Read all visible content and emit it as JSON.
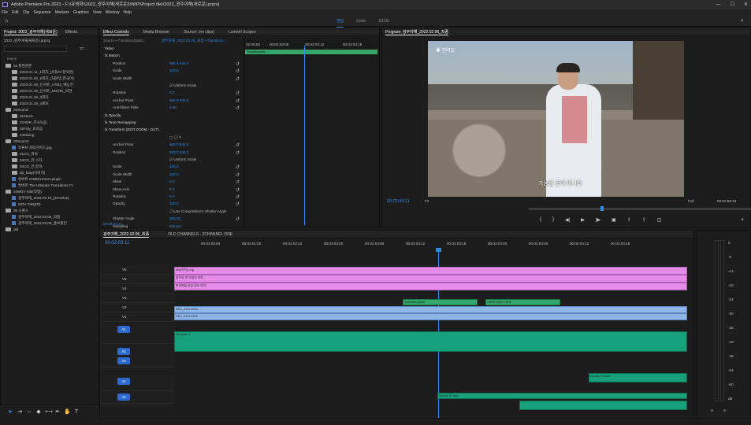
{
  "window": {
    "title": "Adobe Premiere Pro 2021 - F:\\\\유영화\\\\2022_광주야해(새로운)\\\\WIP\\\\Project file\\\\2022_광주야해(새로운).prproj",
    "min": "—",
    "max": "☐",
    "close": "✕"
  },
  "menu": [
    "File",
    "Edit",
    "Clip",
    "Sequence",
    "Markers",
    "Graphics",
    "View",
    "Window",
    "Help"
  ],
  "workspaces": {
    "tabs": [
      "편집",
      "Color",
      "오디오"
    ],
    "active": 0
  },
  "project": {
    "tab": "Project: 2022_광주야해(새로운)",
    "tab2": "Effects",
    "path": "2022_광주야해(새로운).prproj",
    "count": "37...",
    "col": "Name",
    "items": [
      {
        "t": "folder",
        "l": "01.촬영원본",
        "i": 0
      },
      {
        "t": "folder",
        "l": "2022.01.11_1회차_(유튜브 분석본)",
        "i": 1
      },
      {
        "t": "folder",
        "l": "2022.01.20_2회차_(대본민,한국어)",
        "i": 1
      },
      {
        "t": "folder",
        "l": "2022.01.28_인서트_A7M3_예능진",
        "i": 1
      },
      {
        "t": "folder",
        "l": "2022.01.28_인서트_NIKON_박현",
        "i": 1
      },
      {
        "t": "folder",
        "l": "2022.01.29_3회차",
        "i": 1
      },
      {
        "t": "folder",
        "l": "2022.01.29_4회차",
        "i": 1
      },
      {
        "t": "folder",
        "l": "02Sound",
        "i": 0
      },
      {
        "t": "folder",
        "l": "01Music",
        "i": 1
      },
      {
        "t": "folder",
        "l": "02ADR_추사녹음",
        "i": 1
      },
      {
        "t": "folder",
        "l": "03Foly_효과음",
        "i": 1
      },
      {
        "t": "folder",
        "l": "04Mixing",
        "i": 1
      },
      {
        "t": "folder",
        "l": "03Source",
        "i": 0
      },
      {
        "t": "clip",
        "l": "유튜브 자막가이드.jpg",
        "i": 1
      },
      {
        "t": "folder",
        "l": "01CG_자막",
        "i": 1
      },
      {
        "t": "folder",
        "l": "03CG_전 스타",
        "i": 1
      },
      {
        "t": "folder",
        "l": "04CG_전 끝까",
        "i": 1
      },
      {
        "t": "folder",
        "l": "06_Map(이미지)",
        "i": 1
      },
      {
        "t": "clip",
        "l": "컨버트 CINEPUNCH plugin",
        "i": 1
      },
      {
        "t": "clip",
        "l": "컨버트 The Ultimate Transitions Fx",
        "i": 1
      },
      {
        "t": "folder",
        "l": "04MOV File(작업)",
        "i": 0
      },
      {
        "t": "clip",
        "l": "광주야해_2022.02.10_(Resolve)",
        "i": 1
      },
      {
        "t": "clip",
        "l": "MOV File(ED)",
        "i": 1
      },
      {
        "t": "folder",
        "l": "05.시퀀스",
        "i": 0
      },
      {
        "t": "clip",
        "l": "광주야해_2022.02.06_최종",
        "i": 1
      },
      {
        "t": "clip",
        "l": "광주야해_2022.02.06_풍보풍인",
        "i": 1
      },
      {
        "t": "folder",
        "l": "old",
        "i": 0
      }
    ]
  },
  "effects": {
    "tabs": [
      "Effect Controls",
      "Media Browser",
      "Source: (no clips)",
      "Lumetri Scopes"
    ],
    "source": "Source • Transition(fade)...",
    "seq": "광주야해_2022.02.06_최종 • Transition...",
    "rows": [
      {
        "l": "Video",
        "v": "",
        "h": 1
      },
      {
        "l": "fx  Motion",
        "v": "",
        "h": 1
      },
      {
        "l": "Position",
        "v": "960.0   540.0",
        "k": 1
      },
      {
        "l": "Scale",
        "v": "100.0",
        "k": 1
      },
      {
        "l": "Scale Width",
        "v": "",
        "k": 1
      },
      {
        "l": "",
        "v": "☑ Uniform Scale"
      },
      {
        "l": "Rotation",
        "v": "0.0",
        "k": 1
      },
      {
        "l": "Anchor Point",
        "v": "960.0   540.0",
        "k": 1
      },
      {
        "l": "Anti-flicker Filter",
        "v": "0.00",
        "k": 1
      },
      {
        "l": "fx  Opacity",
        "v": "",
        "h": 1
      },
      {
        "l": "fx  Time Remapping",
        "v": "",
        "h": 1
      },
      {
        "l": "fx  Transform (EDIT.ZOOM - OUT)",
        "v": "",
        "h": 1
      },
      {
        "l": "",
        "v": "▢ ◯ ✎"
      },
      {
        "l": "Anchor Point",
        "v": "960.0   540.0",
        "k": 1
      },
      {
        "l": "Position",
        "v": "960.0   540.0",
        "k": 1
      },
      {
        "l": "",
        "v": "☑ Uniform Scale"
      },
      {
        "l": "Scale",
        "v": "100.0",
        "k": 1
      },
      {
        "l": "Scale Width",
        "v": "100.0",
        "k": 1
      },
      {
        "l": "Skew",
        "v": "0.0",
        "k": 1
      },
      {
        "l": "Skew Axis",
        "v": "0.0",
        "k": 1
      },
      {
        "l": "Rotation",
        "v": "0.0",
        "k": 1
      },
      {
        "l": "Opacity",
        "v": "100.0",
        "k": 1
      },
      {
        "l": "",
        "v": "☐ Use Composition's Shutter Angle"
      },
      {
        "l": "Shutter Angle",
        "v": "180.00",
        "k": 1
      },
      {
        "l": "Sampling",
        "v": "Bilinear",
        "k": 0
      }
    ],
    "ruler": [
      "02:05:00",
      "00:02:03:08",
      "00:02:03:12",
      "00:02:03:15"
    ],
    "clipbar": "Transition(fade) ...",
    "timecode": "00:02:03:11"
  },
  "program": {
    "tab": "Program: 광주야해_2022.02.06_최종",
    "timecode": "00:02:03:11",
    "fit": "Fit",
    "full": "Full",
    "duration": "00:02:59:10",
    "subtitle": "가능한 곳이 아니라",
    "location": "◉ 전라도"
  },
  "timeline": {
    "tab": "광주야해_2022.02.06_최종",
    "tab2": "OLD CHANNELS - 2CHANNEL ONE",
    "timecode": "00:02:03:11",
    "ruler": [
      "00:02:00:00",
      "00:02:01:00",
      "00:02:02:12",
      "00:02:03:00",
      "00:02:04:00",
      "00:02:03:12",
      "00:02:03:18",
      "00:02:04:00",
      "00:02:04:06",
      "00:02:04:12",
      "00:02:04:18"
    ],
    "vtracks": [
      "V6",
      "V5",
      "V4",
      "V3",
      "V2",
      "V1"
    ],
    "atracks": [
      "A1",
      "A2",
      "A3",
      "A4",
      "A5"
    ],
    "mix": "Mix",
    "mixval": "0.0",
    "clips": {
      "v6": "title(자막).png",
      "v5a": "광주의 옛 이야기 자막",
      "v5b": "자막 텍스트",
      "v5c": "광주의 옛 이야기 자막",
      "v4a": "한옥마을 옥상 공터 자막",
      "v4b": "설명 자막",
      "v4c": "자막 설명",
      "v3a": "Transition(fade)",
      "v3b": "CINEPUNCH 효과",
      "v2a": "DSC_0102.MOV",
      "v2b": "DSC_0103.MOV",
      "v2c": "DSC_0104.MOV",
      "v2d": "DSC_0105.MOV",
      "a1": "A1 Audio 1",
      "a2": "Audio 2",
      "a3": "Audio 3",
      "a4": "Audio 4",
      "a4clip": "Sound_01.wav",
      "a5clip": "Sound_02.wav"
    }
  },
  "meter": {
    "scale": [
      "0",
      "-6",
      "-12",
      "-18",
      "-24",
      "-30",
      "-36",
      "-42",
      "-48",
      "-54",
      "-60",
      "dB"
    ],
    "s": "S",
    "s2": "S"
  }
}
